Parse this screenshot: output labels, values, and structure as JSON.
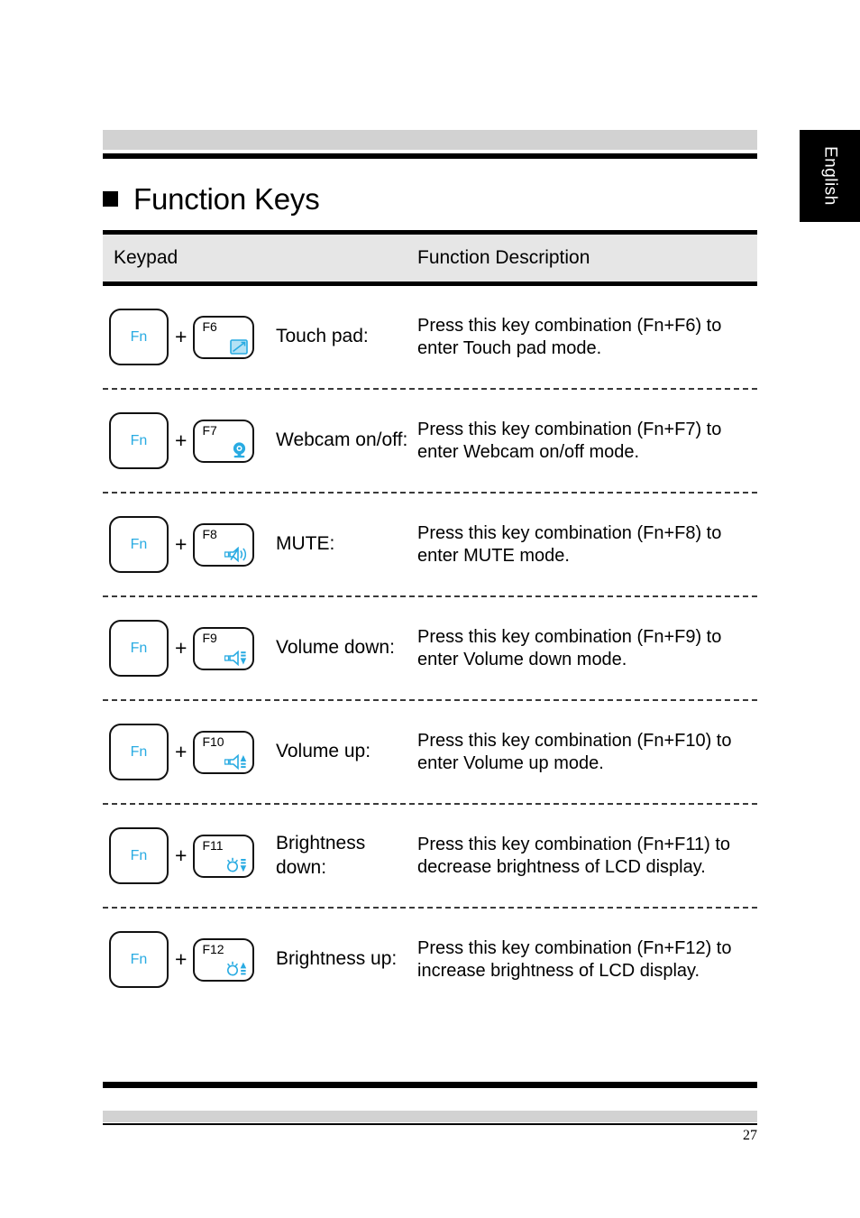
{
  "document": {
    "language_tab": "English",
    "page_number": "27",
    "title": "Function Keys"
  },
  "table": {
    "headers": {
      "keypad": "Keypad",
      "description": "Function Description"
    },
    "rows": [
      {
        "modifier_key": "Fn",
        "separator": "+",
        "function_key": "F6",
        "icon": "touchpad-icon",
        "label": "Touch pad:",
        "description": "Press this key combination (Fn+F6) to enter Touch pad mode."
      },
      {
        "modifier_key": "Fn",
        "separator": "+",
        "function_key": "F7",
        "icon": "webcam-icon",
        "label": "Webcam on/off:",
        "description": "Press this key combination (Fn+F7) to enter Webcam on/off mode."
      },
      {
        "modifier_key": "Fn",
        "separator": "+",
        "function_key": "F8",
        "icon": "speaker-mute-icon",
        "label": "MUTE:",
        "description": "Press this key combination (Fn+F8) to enter MUTE mode."
      },
      {
        "modifier_key": "Fn",
        "separator": "+",
        "function_key": "F9",
        "icon": "volume-down-icon",
        "label": "Volume down:",
        "description": "Press this key combination (Fn+F9) to enter Volume down mode."
      },
      {
        "modifier_key": "Fn",
        "separator": "+",
        "function_key": "F10",
        "icon": "volume-up-icon",
        "label": "Volume up:",
        "description": "Press this key combination (Fn+F10) to enter Volume up mode."
      },
      {
        "modifier_key": "Fn",
        "separator": "+",
        "function_key": "F11",
        "icon": "brightness-down-icon",
        "label": "Brightness down:",
        "description": "Press this key combination (Fn+F11) to decrease brightness of LCD display."
      },
      {
        "modifier_key": "Fn",
        "separator": "+",
        "function_key": "F12",
        "icon": "brightness-up-icon",
        "label": "Brightness up:",
        "description": "Press this key combination (Fn+F12) to increase brightness of LCD display."
      }
    ]
  },
  "colors": {
    "accent_blue": "#29abe2",
    "band_gray": "#d2d2d2",
    "header_gray": "#e6e6e6",
    "rule_black": "#000000"
  }
}
